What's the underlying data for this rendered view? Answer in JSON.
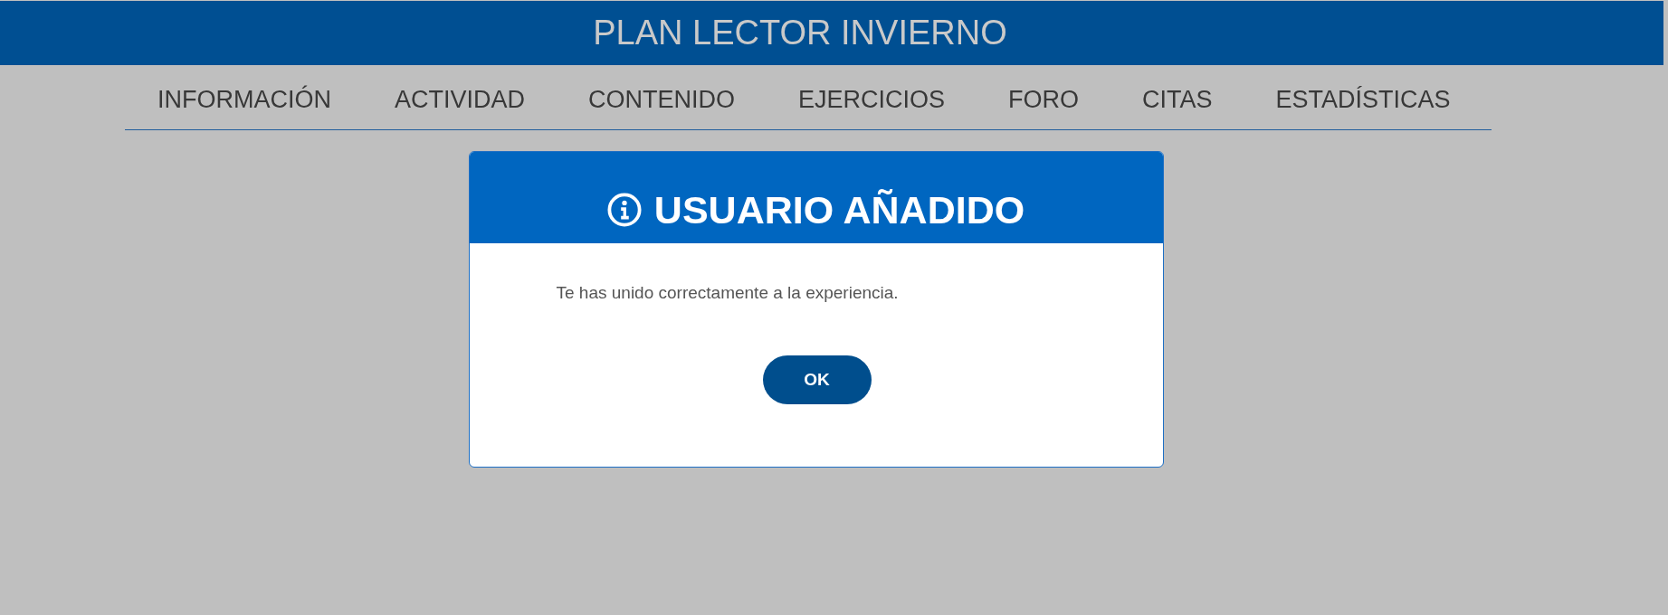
{
  "header": {
    "title": "PLAN LECTOR INVIERNO"
  },
  "nav": {
    "items": [
      {
        "label": "INFORMACIÓN"
      },
      {
        "label": "ACTIVIDAD"
      },
      {
        "label": "CONTENIDO"
      },
      {
        "label": "EJERCICIOS"
      },
      {
        "label": "FORO"
      },
      {
        "label": "CITAS"
      },
      {
        "label": "ESTADÍSTICAS"
      }
    ]
  },
  "dialog": {
    "title": "USUARIO AÑADIDO",
    "message": "Te has unido correctamente a la experiencia.",
    "buttons": [
      {
        "label": "OK"
      }
    ]
  }
}
